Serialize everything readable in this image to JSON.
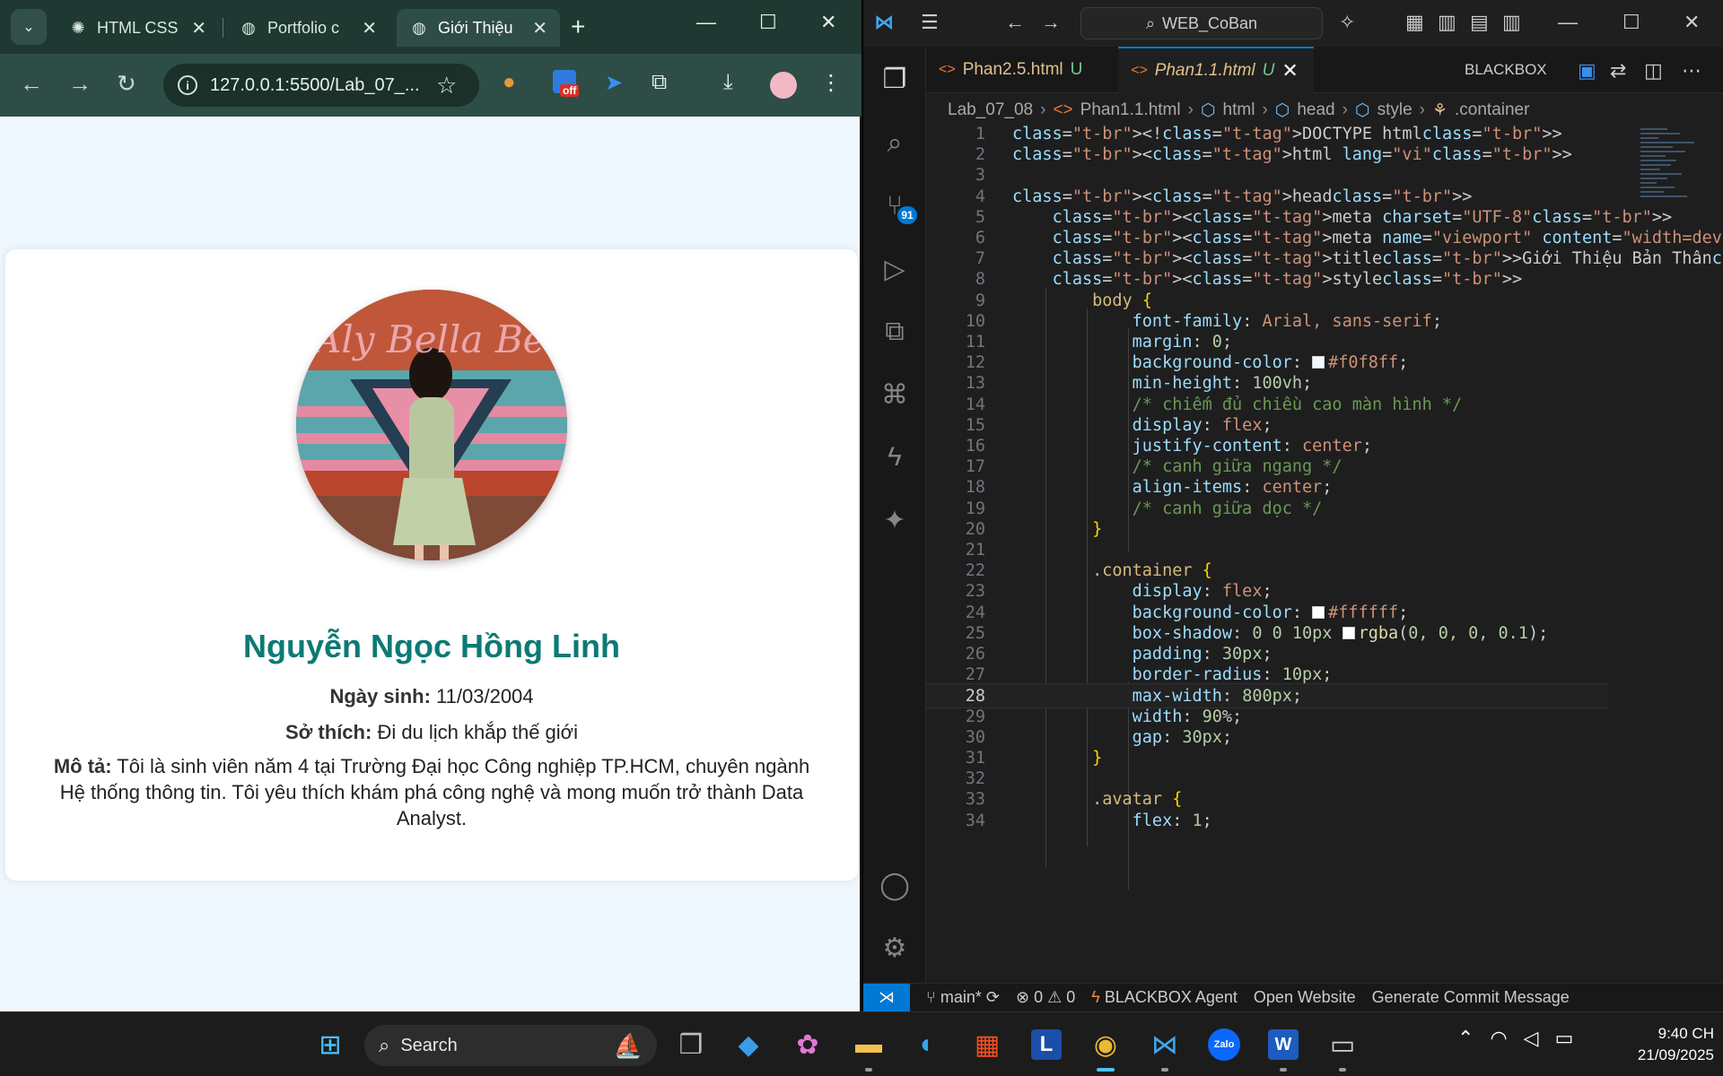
{
  "browser": {
    "tabs": [
      {
        "title": "HTML CSS",
        "icon": "openai-icon"
      },
      {
        "title": "Portfolio c",
        "icon": "globe-icon"
      },
      {
        "title": "Giới Thiệu",
        "icon": "globe-icon"
      }
    ],
    "url": "127.0.0.1:5500/Lab_07_...",
    "extension_badge": "off"
  },
  "profile": {
    "avatar_text": "Aly Bella Bea",
    "name": "Nguyễn Ngọc Hồng Linh",
    "birth_label": "Ngày sinh:",
    "birth_value": "11/03/2004",
    "hobby_label": "Sở thích:",
    "hobby_value": "Đi du lịch khắp thế giới",
    "desc_label": "Mô tả:",
    "desc_value": "Tôi là sinh viên năm 4 tại Trường Đại học Công nghiệp TP.HCM, chuyên ngành Hệ thống thông tin. Tôi yêu thích khám phá công nghệ và mong muốn trở thành Data Analyst."
  },
  "vscode": {
    "search_label": "WEB_CoBan",
    "scm_badge": "91",
    "editor_tabs": [
      {
        "name": "Phan2.5.html",
        "status": "U"
      },
      {
        "name": "Phan1.1.html",
        "status": "U"
      }
    ],
    "blackbox_label": "BLACKBOX",
    "breadcrumb": [
      "Lab_07_08",
      "Phan1.1.html",
      "html",
      "head",
      "style",
      ".container"
    ],
    "current_line": 28,
    "code_lines": [
      "<!DOCTYPE html>",
      "<html lang=\"vi\">",
      "",
      "<head>",
      "    <meta charset=\"UTF-8\">",
      "    <meta name=\"viewport\" content=\"width=device-width, initi",
      "    <title>Giới Thiệu Bản Thân</title>",
      "    <style>",
      "        body {",
      "            font-family: Arial, sans-serif;",
      "            margin: 0;",
      "            background-color: #f0f8ff;",
      "            min-height: 100vh;",
      "            /* chiếm đủ chiều cao màn hình */",
      "            display: flex;",
      "            justify-content: center;",
      "            /* canh giữa ngang */",
      "            align-items: center;",
      "            /* canh giữa dọc */",
      "        }",
      "",
      "        .container {",
      "            display: flex;",
      "            background-color: #ffffff;",
      "            box-shadow: 0 0 10px rgba(0, 0, 0, 0.1);",
      "            padding: 30px;",
      "            border-radius: 10px;",
      "            max-width: 800px;",
      "            width: 90%;",
      "            gap: 30px;",
      "        }",
      "",
      "        .avatar {",
      "            flex: 1;"
    ],
    "status": {
      "branch": "main*",
      "errors": "0",
      "warnings": "0",
      "items": [
        "BLACKBOX Agent",
        "Open Website",
        "Generate Commit Message"
      ]
    }
  },
  "taskbar": {
    "search_placeholder": "Search",
    "time": "9:40 CH",
    "date": "21/09/2025"
  },
  "colors": {
    "page_bg": "#f0f8ff",
    "name_color": "#0c7a74",
    "vscode_accent": "#0078d4",
    "browser_frame": "#2e4d46"
  }
}
